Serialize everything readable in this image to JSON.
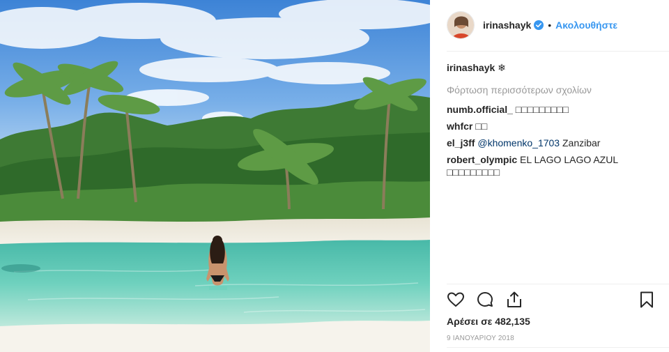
{
  "post": {
    "username": "irinashayk",
    "follow_label": "Ακολουθήστε",
    "separator": "•"
  },
  "caption": {
    "username": "irinashayk",
    "text": "❄"
  },
  "load_more_label": "Φόρτωση περισσότερων σχολίων",
  "comments": [
    {
      "username": "numb.official_",
      "text": "□□□□□□□□□"
    },
    {
      "username": "whfcr",
      "text": "□□"
    },
    {
      "username": "el_j3ff",
      "mention": "@khomenko_1703",
      "text": " Zanzibar"
    },
    {
      "username": "robert_olympic",
      "text": "EL LAGO LAGO AZUL □□□□□□□□□"
    }
  ],
  "likes_label": "Αρέσει σε 482,135",
  "date_label": "9 ΙΑΝΟΥΑΡΙΟΥ 2018",
  "icons": {
    "like": "heart-icon",
    "comment": "comment-icon",
    "share": "share-icon",
    "save": "bookmark-icon",
    "verified": "verified-badge-icon"
  },
  "colors": {
    "link_blue": "#3897f0",
    "muted": "#999999",
    "text": "#262626"
  }
}
